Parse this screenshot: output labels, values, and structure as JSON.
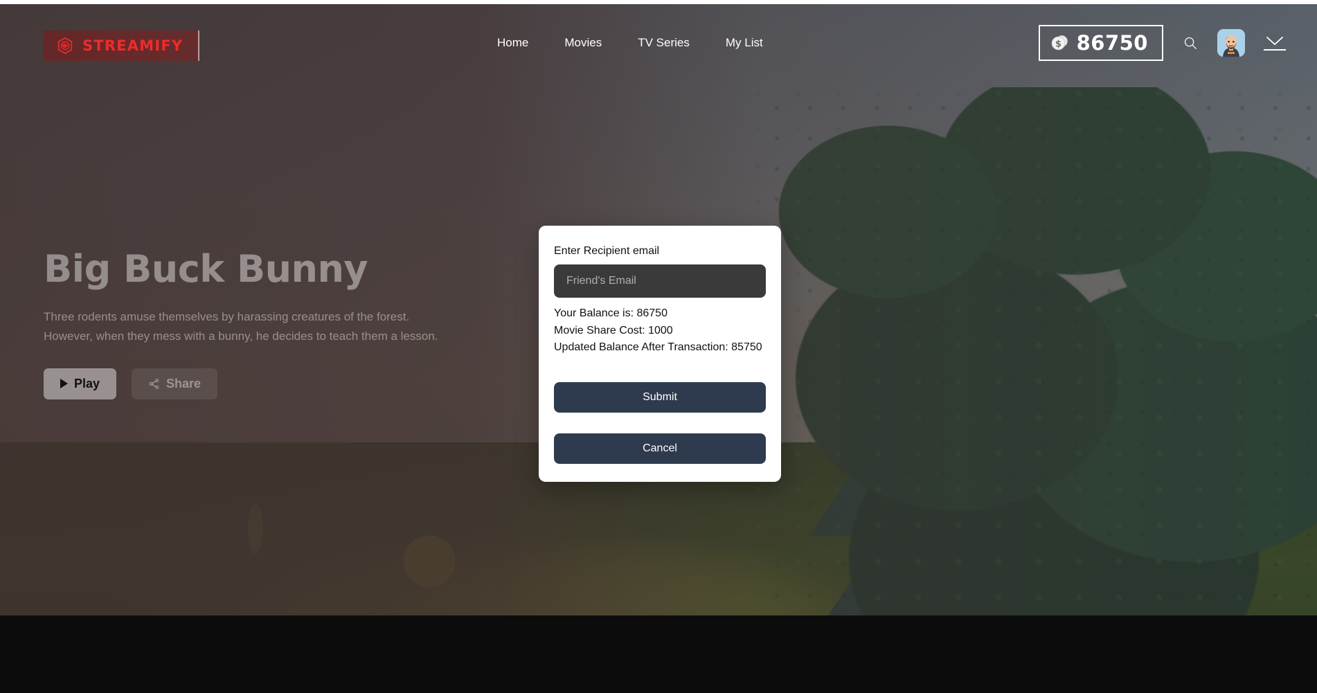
{
  "app": {
    "brand_name": "STREAMIFY",
    "brand_color": "#ef2b2b",
    "accent_modal_button": "#2e3b4e"
  },
  "header": {
    "logo_label": "STREAMIFY",
    "nav": [
      {
        "label": "Home"
      },
      {
        "label": "Movies"
      },
      {
        "label": "TV Series"
      },
      {
        "label": "My List"
      }
    ],
    "balance": {
      "amount": "86750",
      "icon": "coins-icon"
    },
    "search_icon": "search-icon",
    "avatar_alt": "user-avatar",
    "account_caret_icon": "chevron-down-icon"
  },
  "hero": {
    "title": "Big Buck Bunny",
    "description": "Three rodents amuse themselves by harassing creatures of the forest. However, when they mess with a bunny, he decides to teach them a lesson.",
    "play_label": "Play",
    "share_label": "Share"
  },
  "modal": {
    "label": "Enter Recipient email",
    "input_placeholder": "Friend's Email",
    "input_value": "",
    "balance_line": "Your Balance is: 86750",
    "cost_line": "Movie Share Cost: 1000",
    "updated_line": "Updated Balance After Transaction: 85750",
    "submit_label": "Submit",
    "cancel_label": "Cancel"
  }
}
